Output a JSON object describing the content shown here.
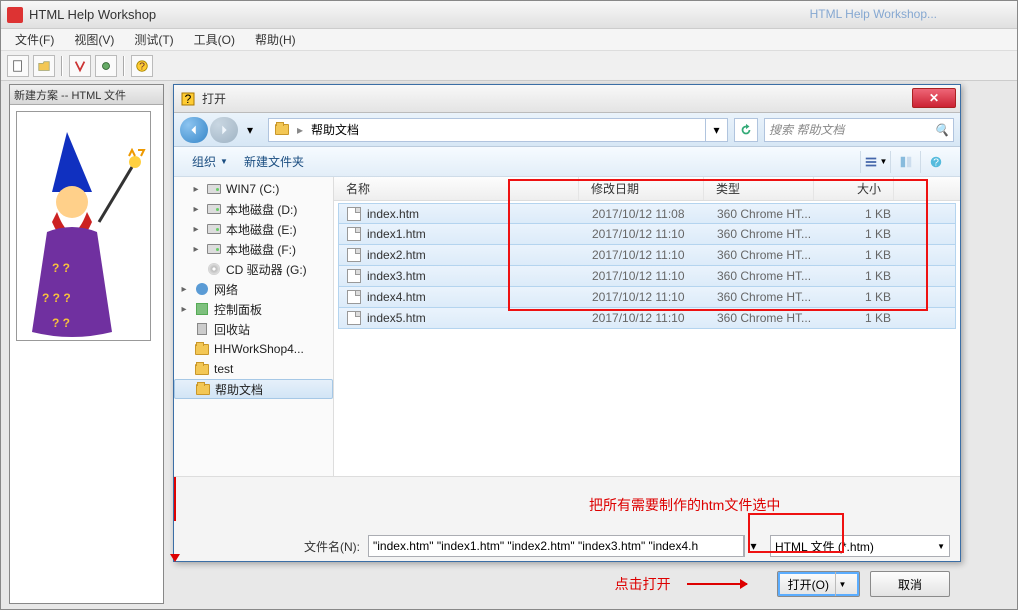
{
  "main": {
    "title": "HTML Help Workshop",
    "taskbar_hint": "HTML Help Workshop...",
    "menu": {
      "file": "文件(F)",
      "view": "视图(V)",
      "test": "测试(T)",
      "tools": "工具(O)",
      "help": "帮助(H)"
    }
  },
  "child_window": {
    "title": "新建方案 -- HTML 文件"
  },
  "dialog": {
    "title": "打开",
    "breadcrumb": {
      "folder": "帮助文档"
    },
    "search_placeholder": "搜索 帮助文档",
    "toolbar": {
      "organize": "组织",
      "new_folder": "新建文件夹"
    },
    "tree": [
      {
        "label": "WIN7 (C:)",
        "icon": "drive",
        "twisty": "▸",
        "indent": 12
      },
      {
        "label": "本地磁盘 (D:)",
        "icon": "drive",
        "twisty": "▸",
        "indent": 12
      },
      {
        "label": "本地磁盘 (E:)",
        "icon": "drive",
        "twisty": "▸",
        "indent": 12
      },
      {
        "label": "本地磁盘 (F:)",
        "icon": "drive",
        "twisty": "▸",
        "indent": 12
      },
      {
        "label": "CD 驱动器 (G:)",
        "icon": "cd",
        "twisty": "",
        "indent": 12
      },
      {
        "label": "网络",
        "icon": "net",
        "twisty": "▸",
        "indent": 0
      },
      {
        "label": "控制面板",
        "icon": "cpl",
        "twisty": "▸",
        "indent": 0
      },
      {
        "label": "回收站",
        "icon": "bin",
        "twisty": "",
        "indent": 0
      },
      {
        "label": "HHWorkShop4...",
        "icon": "folder",
        "twisty": "",
        "indent": 0
      },
      {
        "label": "test",
        "icon": "folder",
        "twisty": "",
        "indent": 0
      },
      {
        "label": "帮助文档",
        "icon": "folder",
        "twisty": "",
        "indent": 0,
        "selected": true
      }
    ],
    "headers": {
      "name": "名称",
      "date": "修改日期",
      "type": "类型",
      "size": "大小"
    },
    "files": [
      {
        "name": "index.htm",
        "date": "2017/10/12 11:08",
        "type": "360 Chrome HT...",
        "size": "1 KB"
      },
      {
        "name": "index1.htm",
        "date": "2017/10/12 11:10",
        "type": "360 Chrome HT...",
        "size": "1 KB"
      },
      {
        "name": "index2.htm",
        "date": "2017/10/12 11:10",
        "type": "360 Chrome HT...",
        "size": "1 KB"
      },
      {
        "name": "index3.htm",
        "date": "2017/10/12 11:10",
        "type": "360 Chrome HT...",
        "size": "1 KB"
      },
      {
        "name": "index4.htm",
        "date": "2017/10/12 11:10",
        "type": "360 Chrome HT...",
        "size": "1 KB"
      },
      {
        "name": "index5.htm",
        "date": "2017/10/12 11:10",
        "type": "360 Chrome HT...",
        "size": "1 KB"
      }
    ],
    "footer": {
      "filename_label": "文件名(N):",
      "filename_value": "\"index.htm\" \"index1.htm\" \"index2.htm\" \"index3.htm\" \"index4.h",
      "filter": "HTML 文件 (*.htm)",
      "open": "打开(O)",
      "cancel": "取消"
    }
  },
  "annotations": {
    "select_all": "把所有需要制作的htm文件选中",
    "click_open": "点击打开"
  }
}
